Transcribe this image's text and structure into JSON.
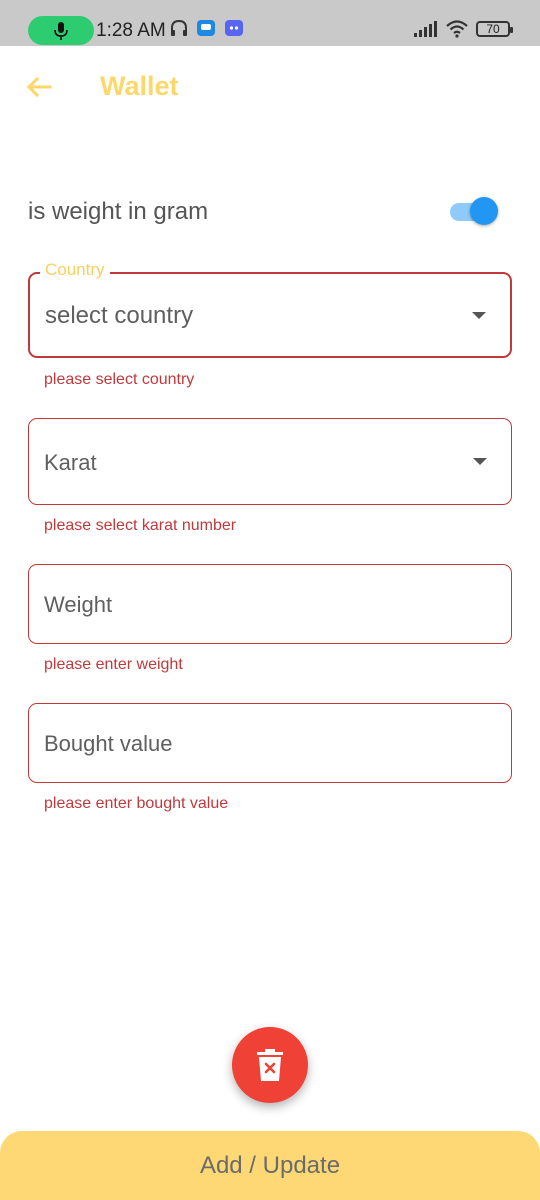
{
  "status_bar": {
    "time": "1:28 AM",
    "battery": "70",
    "icons": [
      "microphone-icon",
      "headphones-icon",
      "chat-app-icon",
      "discord-icon",
      "signal-icon",
      "wifi-icon",
      "battery-icon"
    ]
  },
  "app_bar": {
    "title": "Wallet",
    "back_icon": "arrow-left-icon"
  },
  "toggle": {
    "label": "is weight in gram",
    "checked": true
  },
  "fields": {
    "country": {
      "label": "Country",
      "value": "select country",
      "error": "please select country"
    },
    "karat": {
      "value": "Karat",
      "error": "please select karat number"
    },
    "weight": {
      "placeholder": "Weight",
      "error": "please enter weight"
    },
    "bought_value": {
      "placeholder": "Bought value",
      "error": "please enter bought value"
    }
  },
  "fab": {
    "icon": "delete-icon"
  },
  "bottom_button": {
    "label": "Add / Update"
  },
  "colors": {
    "accent_yellow": "#fcd86a",
    "error_red": "#c0393b",
    "fab_red": "#ef4135",
    "switch_blue": "#2196f3",
    "status_green": "#2ecc71"
  }
}
